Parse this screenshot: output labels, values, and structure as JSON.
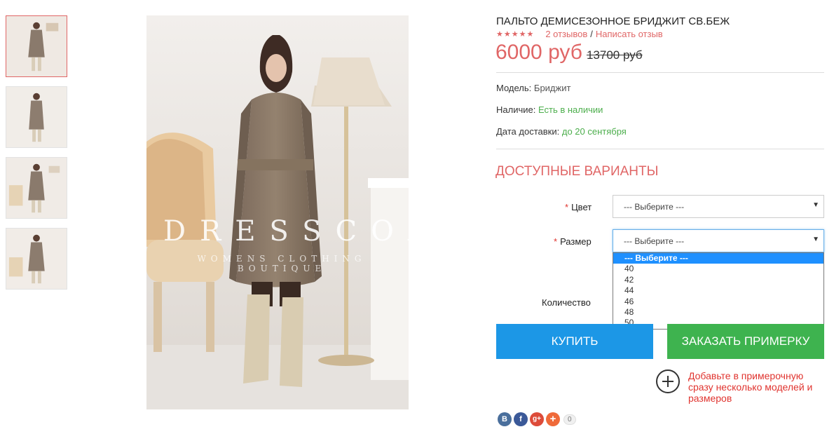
{
  "gallery": {
    "thumbnails": [
      {
        "alt": "coat photo 1",
        "active": true
      },
      {
        "alt": "coat photo 2",
        "active": false
      },
      {
        "alt": "coat photo 3",
        "active": false
      },
      {
        "alt": "coat photo 4",
        "active": false
      }
    ],
    "watermark": {
      "brand": "DRESSCOAT",
      "tagline": "WOMENS CLOTHING BOUTIQUE"
    }
  },
  "product": {
    "title": "ПАЛЬТО ДЕМИСЕЗОННОЕ БРИДЖИТ СВ.БЕЖ",
    "rating_stars": "★★★★★",
    "reviews_link": "2 отзывов",
    "separator": "/",
    "write_review_link": "Написать отзыв",
    "price": "6000 руб",
    "old_price": "13700 руб",
    "model_label": "Модель:",
    "model_value": "Бриджит",
    "availability_label": "Наличие:",
    "availability_value": "Есть в наличии",
    "delivery_label": "Дата доставки:",
    "delivery_value": "до 20 сентября"
  },
  "options": {
    "heading": "ДОСТУПНЫЕ ВАРИАНТЫ",
    "required_mark": "*",
    "color": {
      "label": "Цвет",
      "value": "--- Выберите ---"
    },
    "size": {
      "label": "Размер",
      "value": "--- Выберите ---",
      "options": [
        "--- Выберите ---",
        "40",
        "42",
        "44",
        "46",
        "48",
        "50"
      ],
      "highlighted": "--- Выберите ---"
    },
    "quantity_label": "Количество"
  },
  "actions": {
    "buy_label": "КУПИТЬ",
    "fitting_label": "ЗАКАЗАТЬ ПРИМЕРКУ",
    "hint_text": "Добавьте в примерочную сразу несколько моделей и размеров"
  },
  "social": {
    "vk": "В",
    "fb": "f",
    "gplus": "g+",
    "more": "+",
    "count": "0"
  },
  "colors": {
    "accent_red": "#e06666",
    "buy_blue": "#1c97e6",
    "fitting_green": "#3eb34f",
    "in_stock_green": "#4cae4c"
  }
}
